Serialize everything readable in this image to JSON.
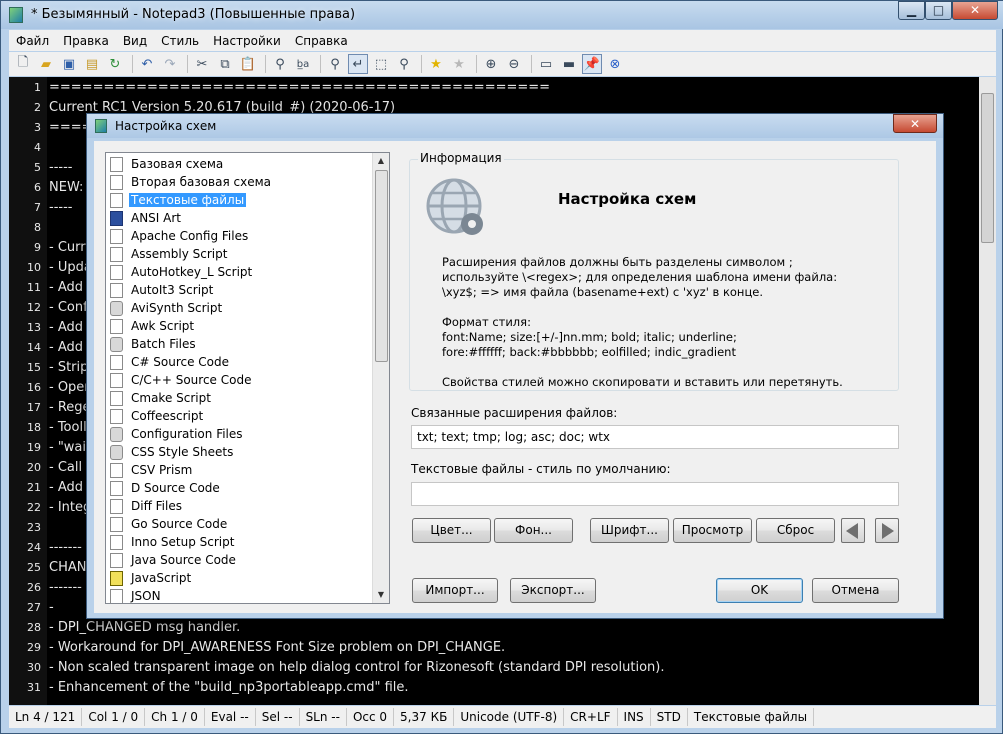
{
  "window": {
    "title": "* Безымянный - Notepad3 (Повышенные права)"
  },
  "menu": [
    "Файл",
    "Правка",
    "Вид",
    "Стиль",
    "Настройки",
    "Справка"
  ],
  "editor": {
    "lines": [
      {
        "n": "1",
        "text": "=============================================="
      },
      {
        "n": "2",
        "text": "Current RC1 Version 5.20.617 (build_#) (2020-06-17)"
      },
      {
        "n": "3",
        "text": "====="
      },
      {
        "n": "4",
        "text": ""
      },
      {
        "n": "5",
        "text": "-----"
      },
      {
        "n": "6",
        "text": "NEW:"
      },
      {
        "n": "7",
        "text": "-----"
      },
      {
        "n": "8",
        "text": ""
      },
      {
        "n": "9",
        "text": "- Curre"
      },
      {
        "n": "10",
        "text": "- Upda"
      },
      {
        "n": "11",
        "text": "- Add"
      },
      {
        "n": "12",
        "text": "- Conf"
      },
      {
        "n": "13",
        "text": "- Add"
      },
      {
        "n": "14",
        "text": "- Add"
      },
      {
        "n": "15",
        "text": "- Strip"
      },
      {
        "n": "16",
        "text": "- Oper"
      },
      {
        "n": "17",
        "text": "- Rege"
      },
      {
        "n": "18",
        "text": "- Tooll"
      },
      {
        "n": "19",
        "text": "- \"wai"
      },
      {
        "n": "20",
        "text": "- Call I"
      },
      {
        "n": "21",
        "text": "- Add"
      },
      {
        "n": "22",
        "text": "- Integ"
      },
      {
        "n": "23",
        "text": ""
      },
      {
        "n": "24",
        "text": "-------"
      },
      {
        "n": "25",
        "text": "CHAN"
      },
      {
        "n": "26",
        "text": "-------"
      },
      {
        "n": "27",
        "text": "-"
      },
      {
        "n": "28",
        "text": "- DPI_CHANGED msg handler."
      },
      {
        "n": "29",
        "text": "- Workaround for DPI_AWARENESS Font Size problem on DPI_CHANGE."
      },
      {
        "n": "30",
        "text": "- Non scaled transparent image on help dialog control for Rizonesoft (standard DPI resolution)."
      },
      {
        "n": "31",
        "text": "- Enhancement of the \"build_np3portableapp.cmd\" file."
      }
    ]
  },
  "status": [
    "Ln 4 / 121",
    "Col 1 / 0",
    "Ch 1 / 0",
    "Eval --",
    "Sel --",
    "SLn --",
    "Occ 0",
    "5,37 КБ",
    "Unicode (UTF-8)",
    "CR+LF",
    "INS",
    "STD",
    "Текстовые файлы"
  ],
  "dialog": {
    "title": "Настройка схем",
    "close": "✕",
    "schemes": [
      {
        "label": "Базовая схема",
        "icon": "file"
      },
      {
        "label": "Вторая базовая схема",
        "icon": "file"
      },
      {
        "label": "Текстовые файлы",
        "icon": "file",
        "selected": true
      },
      {
        "label": "ANSI Art",
        "icon": "special"
      },
      {
        "label": "Apache Config Files",
        "icon": "file"
      },
      {
        "label": "Assembly Script",
        "icon": "file"
      },
      {
        "label": "AutoHotkey_L Script",
        "icon": "file"
      },
      {
        "label": "AutoIt3 Script",
        "icon": "file"
      },
      {
        "label": "AviSynth Script",
        "icon": "gear"
      },
      {
        "label": "Awk Script",
        "icon": "file"
      },
      {
        "label": "Batch Files",
        "icon": "gear"
      },
      {
        "label": "C# Source Code",
        "icon": "file"
      },
      {
        "label": "C/C++ Source Code",
        "icon": "file"
      },
      {
        "label": "Cmake Script",
        "icon": "file"
      },
      {
        "label": "Coffeescript",
        "icon": "file"
      },
      {
        "label": "Configuration Files",
        "icon": "gear"
      },
      {
        "label": "CSS Style Sheets",
        "icon": "gear"
      },
      {
        "label": "CSV Prism",
        "icon": "file"
      },
      {
        "label": "D Source Code",
        "icon": "file"
      },
      {
        "label": "Diff Files",
        "icon": "file"
      },
      {
        "label": "Go Source Code",
        "icon": "file"
      },
      {
        "label": "Inno Setup Script",
        "icon": "file"
      },
      {
        "label": "Java Source Code",
        "icon": "file"
      },
      {
        "label": "JavaScript",
        "icon": "js"
      },
      {
        "label": "JSON",
        "icon": "file"
      }
    ],
    "info": {
      "legend": "Информация",
      "heading": "Настройка схем",
      "lines": [
        "Расширения файлов должны быть разделены символом ;",
        "используйте \\<regex>; для определения шаблона имени файла:",
        " \\xyz$;   => имя файла (basename+ext) с 'xyz' в конце.",
        "",
        "Формат стиля:",
        "font:Name; size:[+/-]nn.mm; bold; italic; underline;",
        "fore:#ffffff; back:#bbbbbb; eolfilled; indic_gradient",
        "",
        "Свойства стилей можно скопировати и вставить или перетянуть."
      ]
    },
    "ext_label": "Связанные расширения файлов:",
    "ext_value": "txt; text; tmp; log; asc; doc; wtx",
    "style_label": "Текстовые файлы - стиль по умолчанию:",
    "style_value": "",
    "buttons": {
      "color": "Цвет...",
      "back": "Фон...",
      "font": "Шрифт...",
      "preview": "Просмотр",
      "reset": "Сброс",
      "import": "Импорт...",
      "export": "Экспорт...",
      "ok": "OK",
      "cancel": "Отмена"
    }
  }
}
